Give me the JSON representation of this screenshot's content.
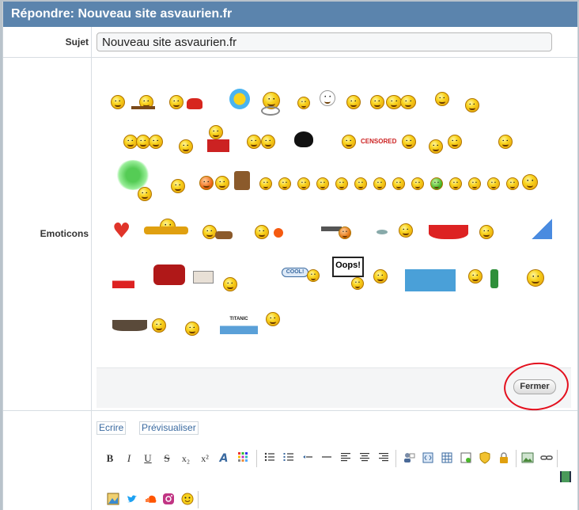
{
  "title": "Répondre: Nouveau site asvaurien.fr",
  "subject": {
    "label": "Sujet",
    "value": "Nouveau site asvaurien.fr"
  },
  "emoticons": {
    "label": "Emoticons",
    "censored_text": "CENSORED",
    "cool_text": "COOL!",
    "oops_text": "Oops!",
    "titanic_text": "TITANIC",
    "close_label": "Fermer"
  },
  "editor": {
    "tabs": [
      {
        "label": "Ecrire"
      },
      {
        "label": "Prévisualiser"
      }
    ],
    "toolbar": {
      "bold": "B",
      "italic": "I",
      "underline": "U",
      "strike": "S",
      "subscript": "x₂",
      "superscript": "x²",
      "font": "A"
    }
  },
  "colors": {
    "titlebar": "#5b84ad",
    "annotation": "#e3101e",
    "link": "#3a6aa0"
  }
}
